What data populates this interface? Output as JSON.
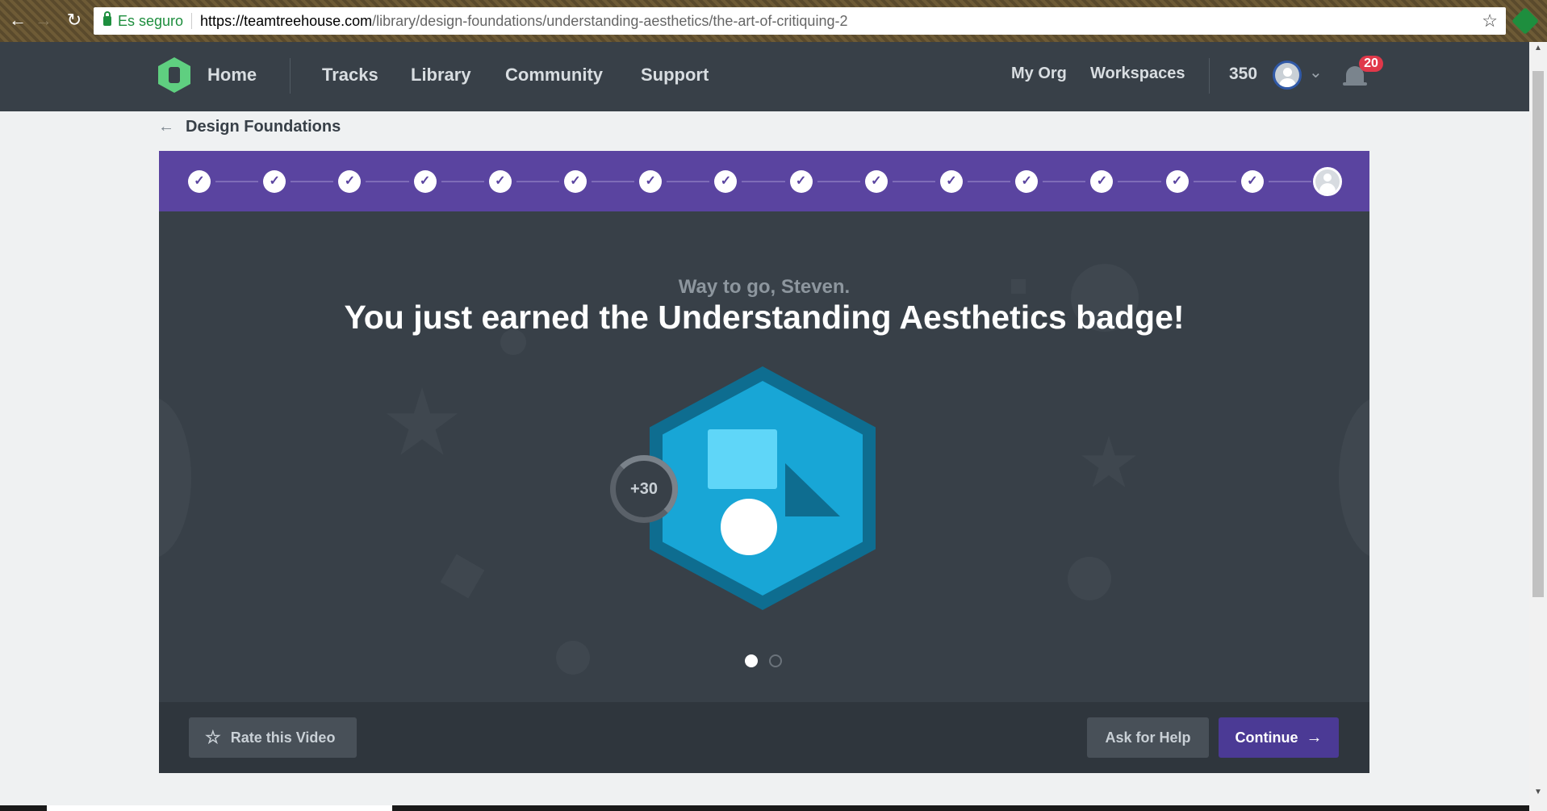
{
  "browser": {
    "secure_label": "Es seguro",
    "url_host": "https://teamtreehouse.com",
    "url_path": "/library/design-foundations/understanding-aesthetics/the-art-of-critiquing-2",
    "back_icon": "arrow-left-icon",
    "forward_icon": "arrow-right-icon",
    "reload_icon": "reload-icon",
    "bookmark_icon": "star-icon"
  },
  "nav": {
    "home": "Home",
    "tracks": "Tracks",
    "library": "Library",
    "community": "Community",
    "support": "Support",
    "my_org": "My Org",
    "workspaces": "Workspaces",
    "points": "350",
    "notifications": "20"
  },
  "breadcrumb": {
    "label": "Design Foundations"
  },
  "progress": {
    "completed_steps": 15,
    "total_steps": 16,
    "check_glyph": "✓"
  },
  "stage": {
    "greeting": "Way to go, Steven.",
    "headline": "You just earned the Understanding Aesthetics badge!",
    "points_earned": "+30",
    "slide_count": 2,
    "active_slide": 1
  },
  "actions": {
    "rate": "Rate this Video",
    "help": "Ask for Help",
    "continue": "Continue"
  },
  "colors": {
    "progress_bg": "#5a44a0",
    "stage_bg": "#384048",
    "badge_outer": "#0e6d90",
    "badge_inner": "#18a6d6",
    "continue_bg": "#4b3a95",
    "notification_badge": "#e0384a"
  }
}
